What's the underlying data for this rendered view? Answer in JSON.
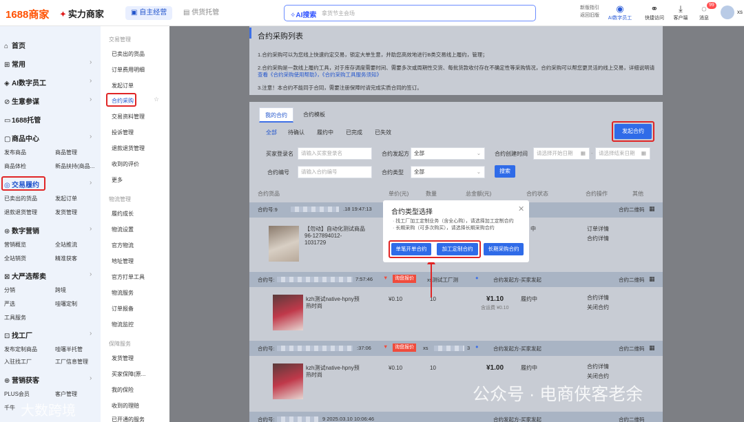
{
  "topbar": {
    "logo": "1688商家",
    "brand": "实力商家",
    "seg_active": "自主经营",
    "seg_other": "供货托管",
    "ai_search": "AI搜索",
    "search_placeholder": "拿货节主会场",
    "link1": "新版指引",
    "link2": "返回旧版",
    "icons": [
      {
        "label": "AI数字员工",
        "icon": "ai-robot"
      },
      {
        "label": "快捷访问",
        "icon": "link"
      },
      {
        "label": "客户端",
        "icon": "download"
      },
      {
        "label": "消息",
        "icon": "message",
        "badge": "99"
      }
    ],
    "user": "xs"
  },
  "sidebar": {
    "groups": [
      {
        "label": "首页"
      },
      {
        "label": "常用"
      },
      {
        "label": "AI数字员工"
      },
      {
        "label": "生意参谋"
      },
      {
        "label": "1688托管"
      },
      {
        "label": "商品中心",
        "subs": [
          "发布商品",
          "商品管理",
          "商品体检",
          "新品扶持(商品..."
        ]
      },
      {
        "label": "交易履约",
        "subs": [
          "已卖出的货品",
          "发起订单",
          "退款退货管理",
          "发货管理"
        ]
      },
      {
        "label": "数字营销",
        "subs": [
          "营销概览",
          "全站推流",
          "全站销货",
          "精准获客"
        ]
      },
      {
        "label": "大严选帮卖",
        "subs": [
          "分销",
          "跨境",
          "严选",
          "哇噻定制",
          "工具服务"
        ]
      },
      {
        "label": "找工厂",
        "subs": [
          "发布定制商品",
          "哇噻半托管",
          "入驻找工厂",
          "工厂信息管理"
        ]
      },
      {
        "label": "营销获客",
        "subs": [
          "PLUS会员",
          "客户管理",
          "千牛"
        ]
      }
    ]
  },
  "sidebar2": {
    "sec1": "交易管理",
    "items1": [
      "已卖出的货品",
      "订单费用明细",
      "发起订单",
      "合约采购",
      "交易资料管理",
      "投诉管理",
      "退款退货管理",
      "收到的评价",
      "更多"
    ],
    "sec2": "物流管理",
    "items2": [
      "履约成长",
      "物流设置",
      "官方物流",
      "地址管理",
      "官方打单工具",
      "物流服务",
      "订单报备",
      "物流监控"
    ],
    "sec3": "保障服务",
    "items3": [
      "发货管理",
      "买家保障(原...",
      "我的保险",
      "收到的理赔",
      "已开通的服务"
    ]
  },
  "main": {
    "title": "合约采购列表",
    "notes": [
      "1.合约采购可以为您线上快速约定交易，锁定大单生意，并助您高效地进行B类交易线上履约，管理；",
      "2.合约采购是一款线上履约工具，对于库存调度需要时间、需要多次或周期性交货、每批货款收付存在不确定性等采购情况，合约采购可以帮您更灵活的线上交易，详细说明请",
      "查看《合约采购使用帮助》，《合约采购工具服务须知》",
      "3.注意！本合约不能同于合同，需要注册保障时请完成实质合同的签订。"
    ],
    "tabs": [
      "我的合约",
      "合约模板"
    ],
    "status_tabs": [
      "全部",
      "待确认",
      "履约中",
      "已完成",
      "已失效"
    ],
    "launch_label": "发起合约",
    "filters": {
      "buyer_label": "买家登录名",
      "buyer_ph": "请输入买家登录名",
      "initiator_label": "合约发起方",
      "initiator_val": "全部",
      "created_label": "合约创建时间",
      "start_ph": "请选择开始日期",
      "end_ph": "请选择结束日期",
      "no_label": "合约编号",
      "no_ph": "请输入合约编号",
      "type_label": "合约类型",
      "type_val": "全部",
      "search": "搜索"
    },
    "columns": [
      "合约货品",
      "单价(元)",
      "数量",
      "总金额(元)",
      "合约状态",
      "合约操作",
      "其他"
    ],
    "orders": [
      {
        "no": "合约号:9",
        "time": ".18 19:47:13",
        "title": "【勿动】自动化测试商品",
        "sku": "96-127894012-",
        "sku2": "1031729",
        "status_frag": "中",
        "ops": [
          "订单详情",
          "合约详情"
        ],
        "qr": "合约二维码"
      },
      {
        "no": "合约号:",
        "time": "7:57:46",
        "tag": "询盘报价",
        "buyer": "xs",
        "party": "xs测试工厂测",
        "initiator": "合约发起方-买家发起",
        "title": "kzh测试native-hpny预",
        "sub": "热时尚",
        "price": "¥0.10",
        "qty": "10",
        "total": "¥1.10",
        "fee": "含运费 ¥0.10",
        "status": "履约中",
        "ops": [
          "合约详情",
          "关闭合约"
        ],
        "qr": "合约二维码"
      },
      {
        "no": "合约号:",
        "time": ":37:06",
        "tag": "询盘报价",
        "buyer": "xs",
        "party": "3",
        "initiator": "合约发起方-买家发起",
        "title": "kzh测试native-hpny预",
        "sub": "热时尚",
        "price": "¥0.10",
        "qty": "10",
        "total": "¥1.00",
        "status": "履约中",
        "ops": [
          "合约详情",
          "关闭合约"
        ],
        "qr": "合约二维码"
      },
      {
        "no": "合约号:",
        "time": "9   2025.03.10 10:06:46",
        "initiator": "合约发起方-买家发起",
        "qr": "合约二维码"
      }
    ],
    "watermark_left": "大数跨境",
    "watermark_right": "公众号 · 电商侠客老余"
  },
  "modal": {
    "title": "合约类型选择",
    "desc1": "· 找工厂加工定制业务（含全心购），请选择加工定制合约",
    "desc2": "· 长期采购（可多次购买），请选择长期采购合约",
    "buttons": [
      "单笔开单合约",
      "加工定制合约",
      "长期采购合约"
    ]
  }
}
